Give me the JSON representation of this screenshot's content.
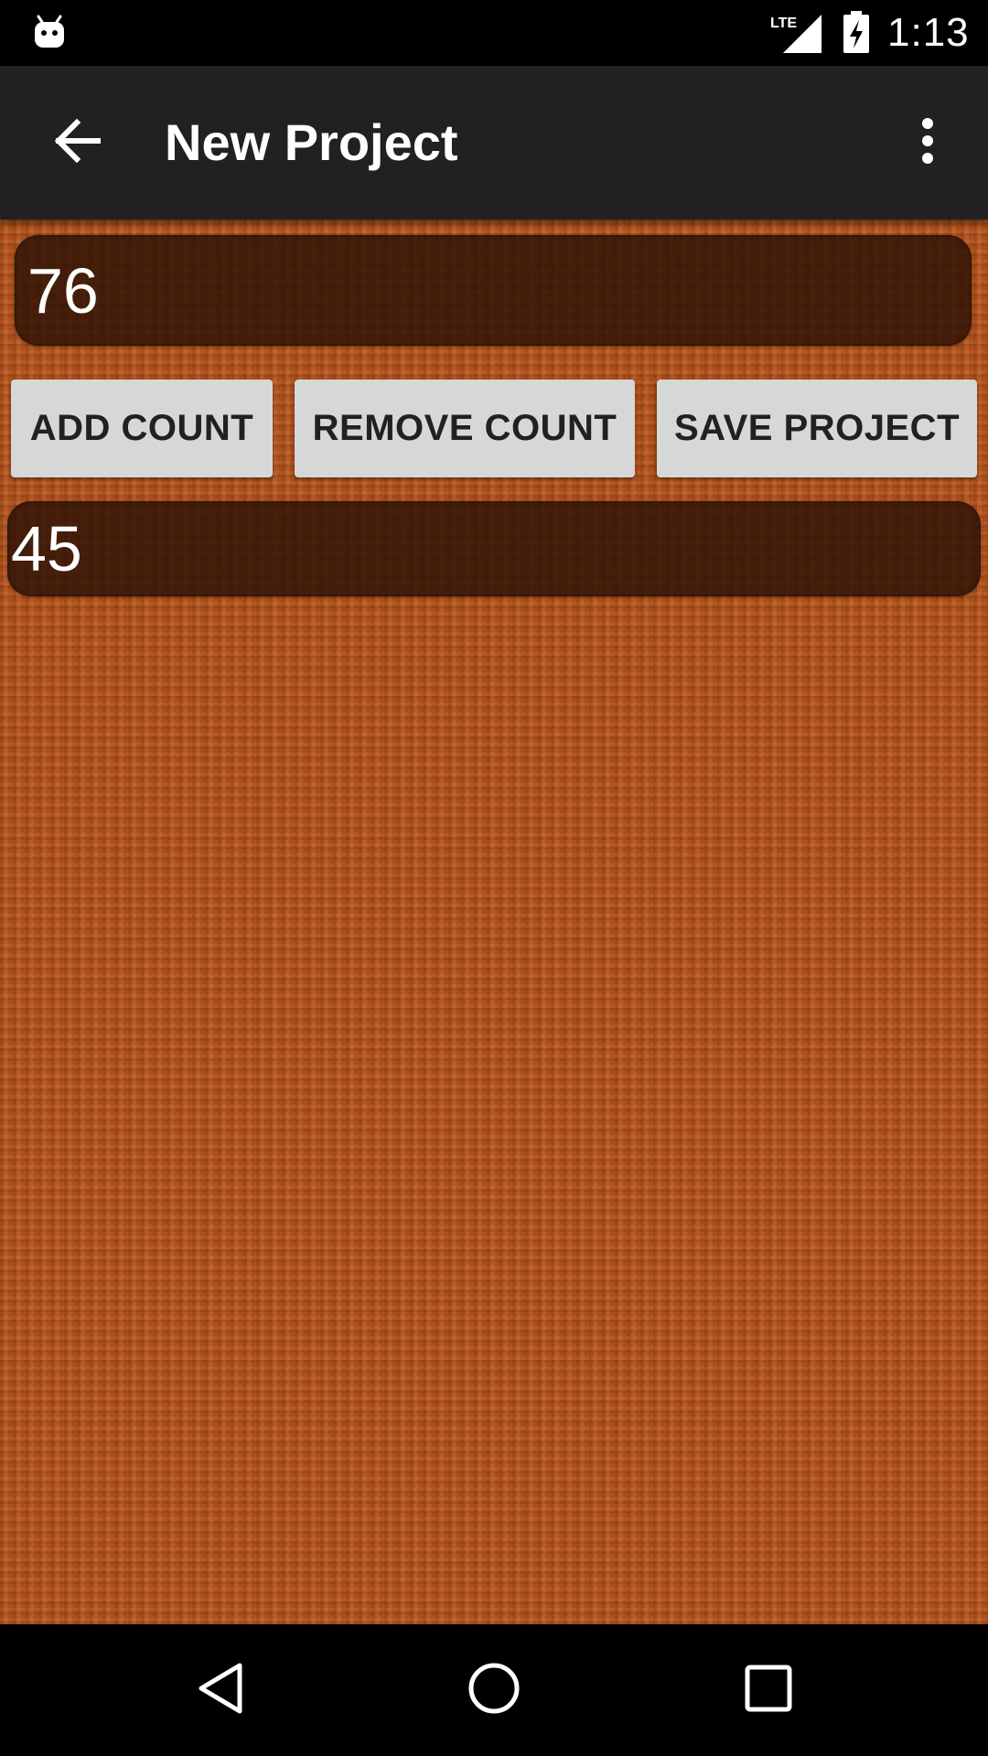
{
  "status_bar": {
    "time": "1:13",
    "network": "LTE",
    "notification_icon": "android-icon",
    "signal_icon": "lte-signal-icon",
    "battery_icon": "battery-charging-icon"
  },
  "app_bar": {
    "title": "New Project",
    "back_icon": "arrow-back-icon",
    "overflow_icon": "more-vert-icon",
    "background_color": "#212121"
  },
  "main": {
    "count_value": "76",
    "secondary_value": "45",
    "buttons": {
      "add_label": "ADD COUNT",
      "remove_label": "REMOVE COUNT",
      "save_label": "SAVE PROJECT"
    },
    "background_color": "#b8541c",
    "display_color": "#2d1206"
  },
  "nav_bar": {
    "back_icon": "triangle-back-icon",
    "home_icon": "circle-home-icon",
    "recents_icon": "square-recents-icon"
  }
}
